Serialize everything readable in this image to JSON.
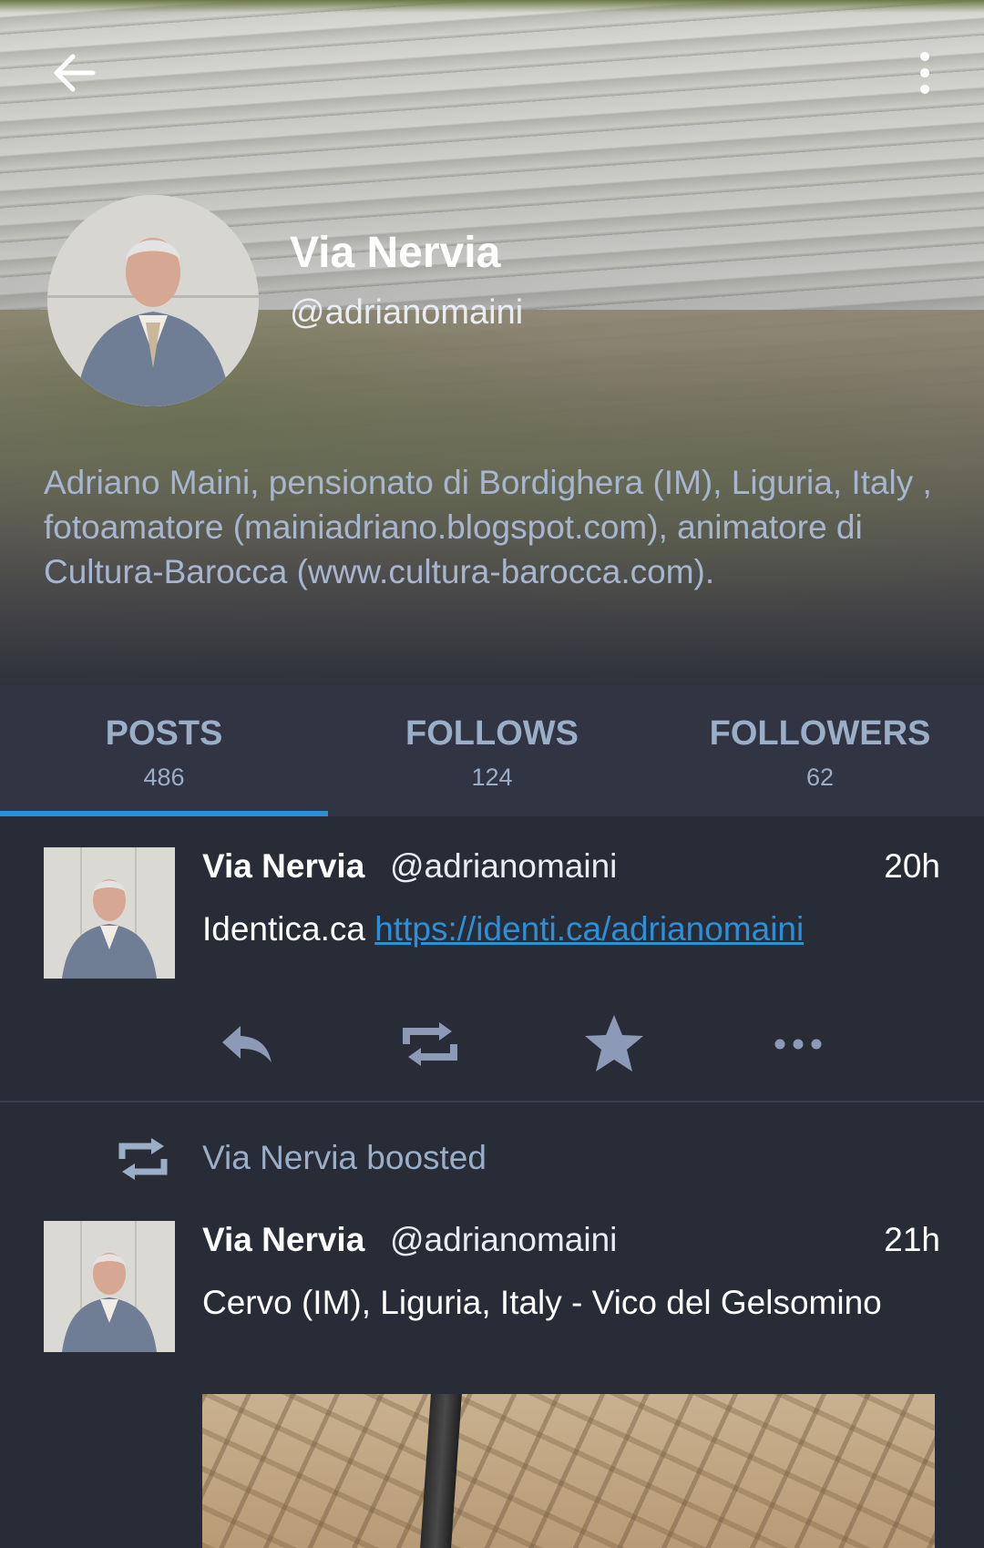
{
  "profile": {
    "display_name": "Via Nervia",
    "handle": "@adrianomaini",
    "bio": "Adriano Maini, pensionato di Bordighera (IM), Liguria, Italy , fotoamatore (mainiadriano.blogspot.com), animatore di Cultura-Barocca (www.cultura-barocca.com)."
  },
  "tabs": [
    {
      "label": "POSTS",
      "count": "486"
    },
    {
      "label": "FOLLOWS",
      "count": "124"
    },
    {
      "label": "FOLLOWERS",
      "count": "62"
    }
  ],
  "posts": [
    {
      "name": "Via Nervia",
      "handle": "@adrianomaini",
      "time": "20h",
      "text_prefix": "Identica.ca ",
      "link": "https://identi.ca/adrianomaini"
    },
    {
      "boost_label": "Via Nervia boosted",
      "name": "Via Nervia",
      "handle": "@adrianomaini",
      "time": "21h",
      "text": "Cervo (IM), Liguria, Italy - Vico del Gelsomino"
    }
  ],
  "colors": {
    "background": "#282c37",
    "tab_bar": "#313543",
    "accent": "#2b90d9",
    "muted": "#9baec8",
    "icon": "#8c9ab8"
  },
  "icons": [
    "back-arrow-icon",
    "more-vertical-icon",
    "reply-icon",
    "boost-icon",
    "favourite-icon",
    "more-horizontal-icon"
  ]
}
